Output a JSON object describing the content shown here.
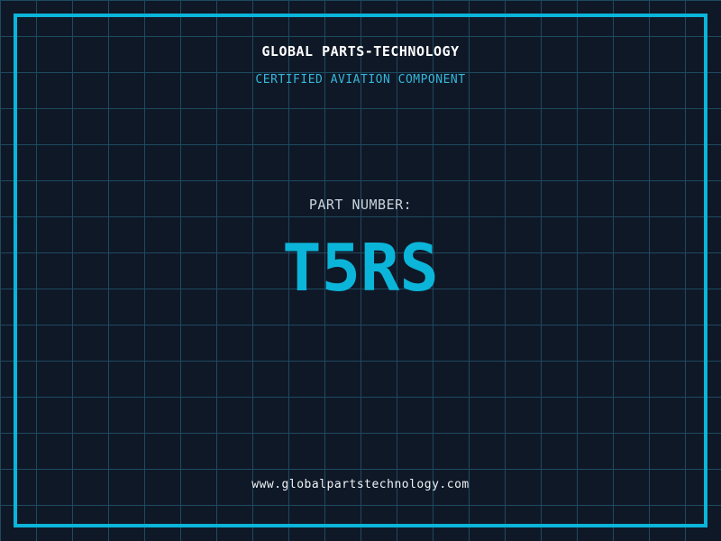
{
  "page": {
    "title": "GLOBAL PARTS-TECHNOLOGY",
    "subtitle": "CERTIFIED AVIATION COMPONENT",
    "part_label": "PART NUMBER:",
    "part_number": "T5RS",
    "website": "www.globalpartstechnology.com"
  },
  "colors": {
    "background": "#0f1827",
    "grid_line": "#1d4a5f",
    "frame_cyan": "#0bb5d9",
    "part_number_cyan": "#0bb5d9",
    "subtitle_cyan": "#35b6d9",
    "title_white": "#ffffff",
    "label_gray": "#c9d4dc",
    "website_white": "#eef3f6"
  }
}
